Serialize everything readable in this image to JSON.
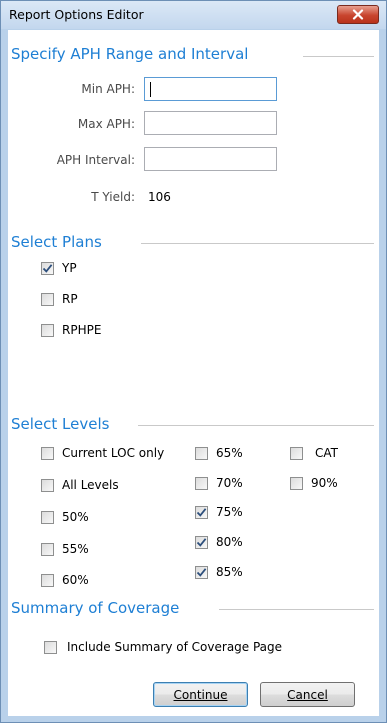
{
  "window": {
    "title": "Report Options Editor",
    "close_icon": "close-icon"
  },
  "aph": {
    "section_title": "Specify APH Range and Interval",
    "min_label": "Min APH:",
    "min_value": "",
    "max_label": "Max APH:",
    "max_value": "",
    "interval_label": "APH Interval:",
    "interval_value": "",
    "tyield_label": "T Yield:",
    "tyield_value": "106"
  },
  "plans": {
    "section_title": "Select Plans",
    "items": [
      {
        "label": "YP",
        "checked": true
      },
      {
        "label": "RP",
        "checked": false
      },
      {
        "label": "RPHPE",
        "checked": false
      }
    ]
  },
  "levels": {
    "section_title": "Select Levels",
    "col1": [
      {
        "label": "Current LOC only",
        "checked": false
      },
      {
        "label": "All Levels",
        "checked": false
      },
      {
        "label": "50%",
        "checked": false
      },
      {
        "label": "55%",
        "checked": false
      },
      {
        "label": "60%",
        "checked": false
      }
    ],
    "col2": [
      {
        "label": "65%",
        "checked": false
      },
      {
        "label": "70%",
        "checked": false
      },
      {
        "label": "75%",
        "checked": true
      },
      {
        "label": "80%",
        "checked": true
      },
      {
        "label": "85%",
        "checked": true
      }
    ],
    "col3": [
      {
        "label": "CAT",
        "checked": false
      },
      {
        "label": "90%",
        "checked": false
      }
    ]
  },
  "summary": {
    "section_title": "Summary of Coverage",
    "include_label": "Include Summary of Coverage Page",
    "include_checked": false
  },
  "buttons": {
    "continue_label": "Continue",
    "cancel_label": "Cancel"
  },
  "colors": {
    "section_title": "#1e7fd4",
    "window_frame": "#b9d1ea"
  }
}
